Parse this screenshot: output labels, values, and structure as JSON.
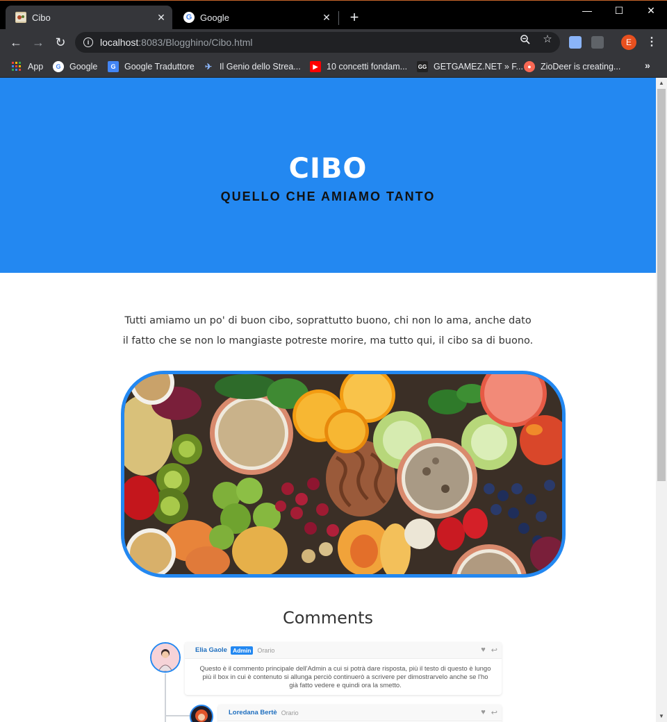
{
  "browser": {
    "tabs": [
      {
        "title": "Cibo",
        "active": true,
        "icon": "cibo-favicon"
      },
      {
        "title": "Google",
        "active": false,
        "icon": "google-favicon"
      }
    ],
    "new_tab_label": "+",
    "window_controls": {
      "minimize": "—",
      "maximize": "☐",
      "close": "✕"
    },
    "address": {
      "host": "localhost",
      "rest": ":8083/Blogghino/Cibo.html"
    },
    "profile_initial": "E",
    "bookmarks": [
      {
        "label": "App",
        "icon": "apps-grid-icon"
      },
      {
        "label": "Google",
        "icon": "google-icon"
      },
      {
        "label": "Google Traduttore",
        "icon": "translate-icon"
      },
      {
        "label": "Il Genio dello Strea...",
        "icon": "bird-icon"
      },
      {
        "label": "10 concetti fondam...",
        "icon": "youtube-icon"
      },
      {
        "label": "GETGAMEZ.NET » F...",
        "icon": "gg-icon"
      },
      {
        "label": "ZioDeer is creating...",
        "icon": "patreon-icon"
      }
    ],
    "bookmarks_overflow": "»"
  },
  "page": {
    "hero": {
      "title": "CIBO",
      "subtitle": "QUELLO CHE AMIAMO TANTO"
    },
    "intro": "Tutti amiamo un po' di buon cibo, soprattutto buono, chi non lo ama, anche dato il fatto che se non lo mangiaste potreste morire, ma tutto qui, il cibo sa di buono.",
    "comments_title": "Comments",
    "comments": [
      {
        "name": "Elia Gaole",
        "badge": "Admin",
        "time": "Orario",
        "text": "Questo è il commento principale dell'Admin a cui si potrà dare risposta, più il testo di questo è lungo più il box in cui è contenuto si allunga perciò continuerò a scrivere per dimostrarvelo anche se l'ho già fatto vedere e quindi ora la smetto."
      },
      {
        "name": "Loredana Bertè",
        "badge": "",
        "time": "Orario",
        "text": ""
      }
    ]
  },
  "colors": {
    "accent": "#2388f1",
    "chrome_dark": "#35363a"
  }
}
